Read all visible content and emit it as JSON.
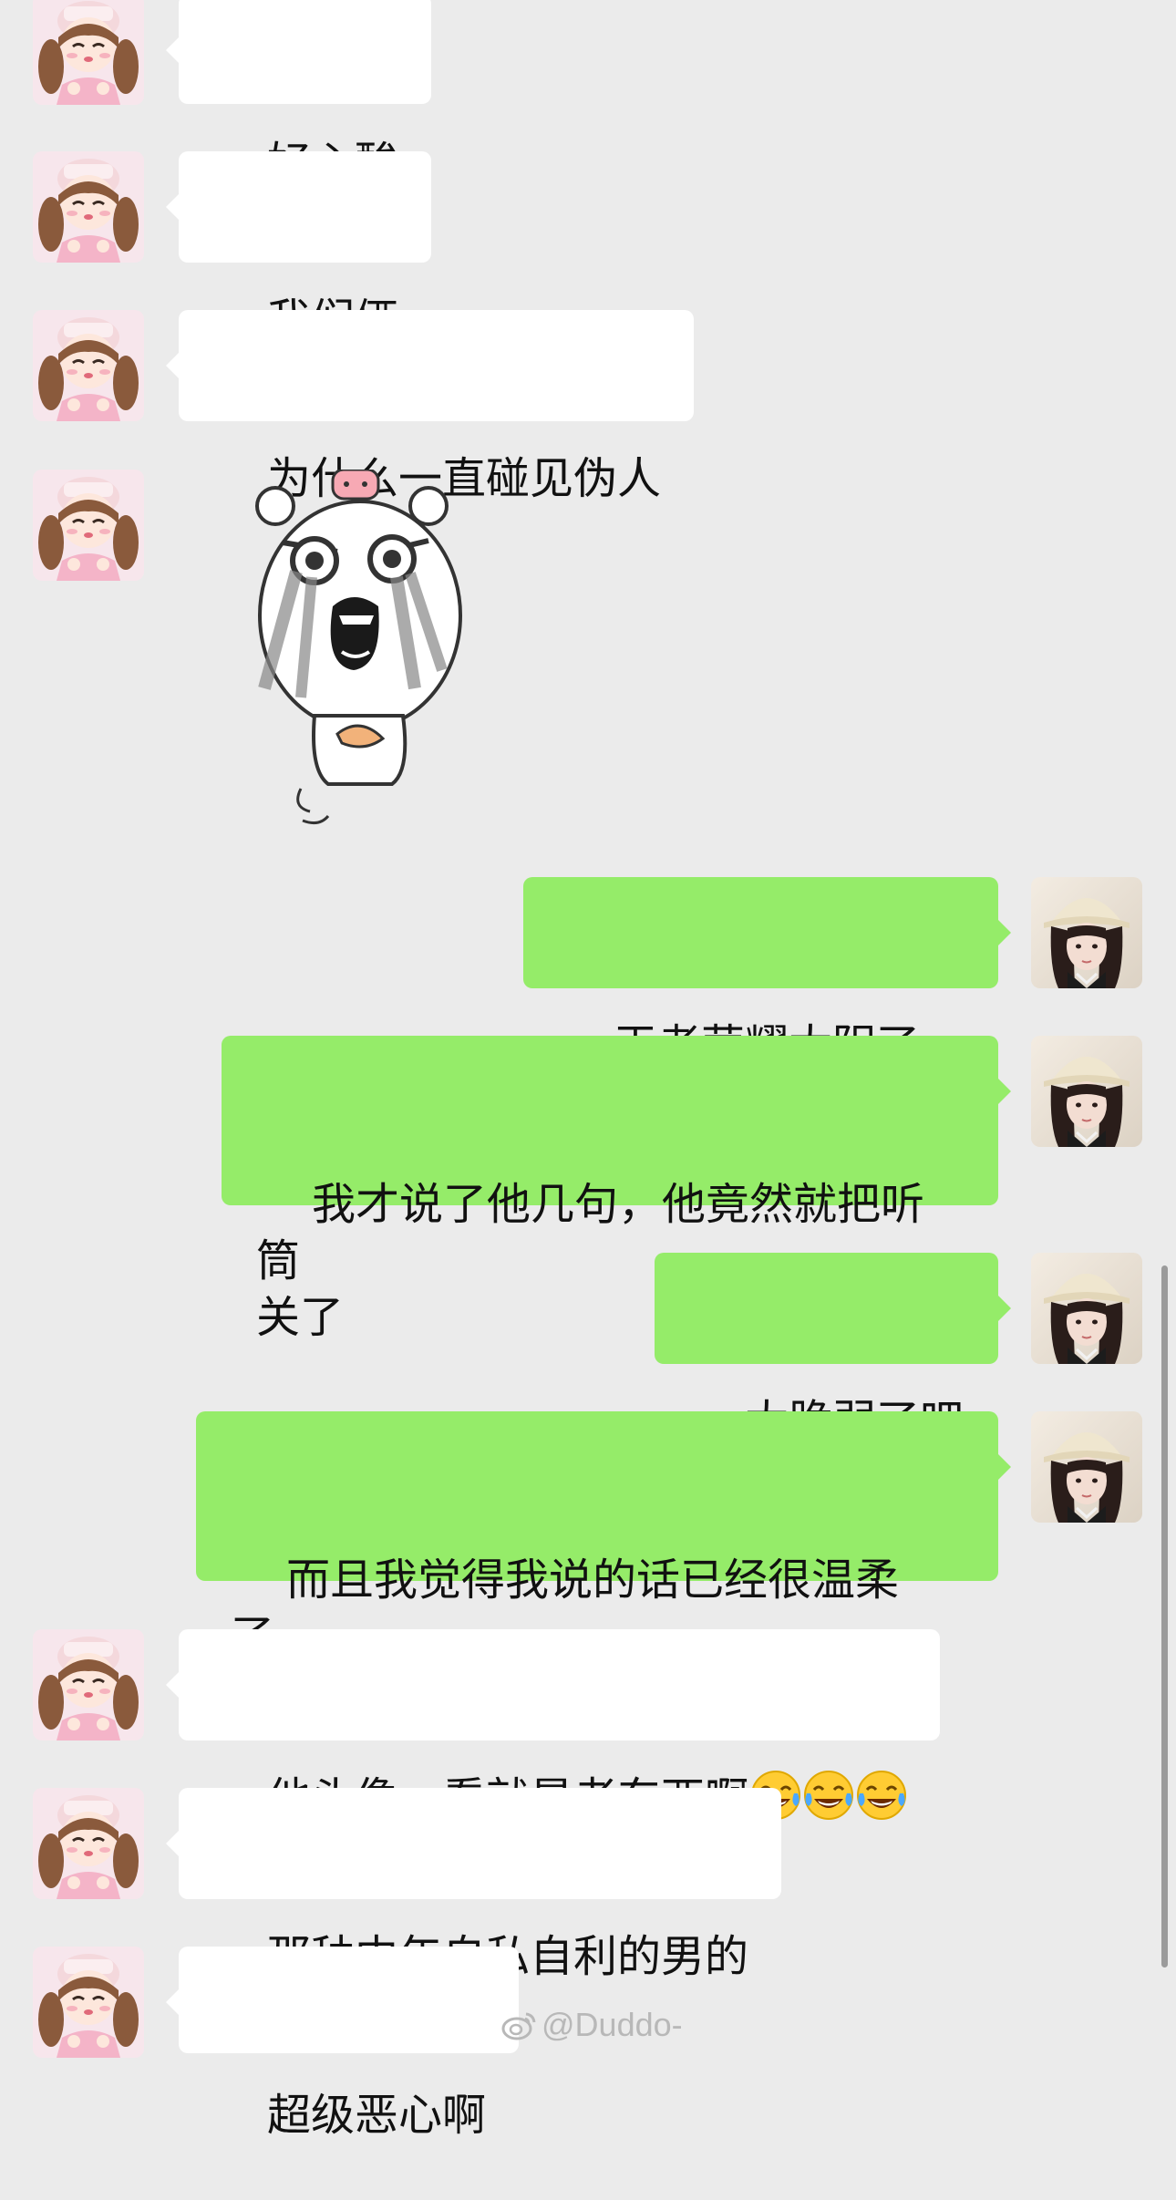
{
  "chat": {
    "messages": [
      {
        "side": "in",
        "kind": "text",
        "text": "好心酸"
      },
      {
        "side": "in",
        "kind": "text",
        "text": "我们俩"
      },
      {
        "side": "in",
        "kind": "text",
        "text": "为什么一直碰见伪人"
      },
      {
        "side": "in",
        "kind": "sticker",
        "sticker_name": "crying-bear-sticker"
      },
      {
        "side": "out",
        "kind": "text",
        "text": "王者荣耀太阴了。"
      },
      {
        "side": "out",
        "kind": "text",
        "text": "我才说了他几句，他竟然就把听筒\n关了"
      },
      {
        "side": "out",
        "kind": "text",
        "text": "太脆弱了吧"
      },
      {
        "side": "out",
        "kind": "text",
        "text": "而且我觉得我说的话已经很温柔了，\n我都没有像平常那样骂"
      },
      {
        "side": "in",
        "kind": "text",
        "text": "他头像一看就是老东西啊",
        "emoji": [
          "tears-of-joy-emoji",
          "tears-of-joy-emoji",
          "tears-of-joy-emoji"
        ]
      },
      {
        "side": "in",
        "kind": "text",
        "text": "那种中年自私自利的男的"
      },
      {
        "side": "in",
        "kind": "text",
        "text": "超级恶心啊"
      }
    ]
  },
  "watermark": {
    "text": "@Duddo-",
    "icon": "weibo-icon"
  },
  "colors": {
    "background": "#ebebeb",
    "incoming_bubble": "#ffffff",
    "outgoing_bubble": "#95ec69",
    "text": "#111111"
  }
}
